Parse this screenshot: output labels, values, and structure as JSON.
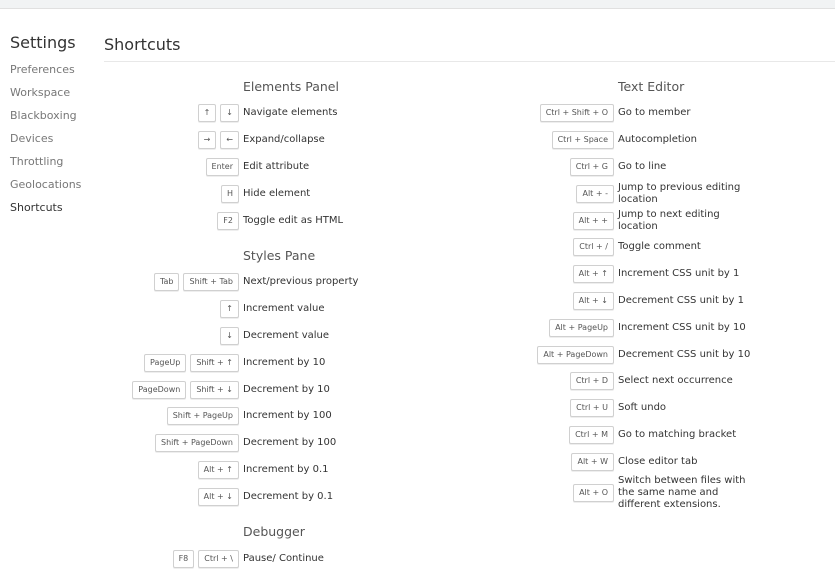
{
  "sidebar": {
    "title": "Settings",
    "items": [
      "Preferences",
      "Workspace",
      "Blackboxing",
      "Devices",
      "Throttling",
      "Geolocations",
      "Shortcuts"
    ]
  },
  "main": {
    "title": "Shortcuts"
  },
  "elements_panel": {
    "title": "Elements Panel",
    "rows": [
      {
        "keys": [
          "↑",
          "↓"
        ],
        "desc": "Navigate elements"
      },
      {
        "keys": [
          "→",
          "←"
        ],
        "desc": "Expand/collapse"
      },
      {
        "keys": [
          "Enter"
        ],
        "desc": "Edit attribute"
      },
      {
        "keys": [
          "H"
        ],
        "desc": "Hide element"
      },
      {
        "keys": [
          "F2"
        ],
        "desc": "Toggle edit as HTML"
      }
    ]
  },
  "styles_pane": {
    "title": "Styles Pane",
    "rows": [
      {
        "keys": [
          "Tab",
          "Shift + Tab"
        ],
        "desc": "Next/previous property"
      },
      {
        "keys": [
          "↑"
        ],
        "desc": "Increment value"
      },
      {
        "keys": [
          "↓"
        ],
        "desc": "Decrement value"
      },
      {
        "keys": [
          "PageUp",
          "Shift + ↑"
        ],
        "desc": "Increment by 10"
      },
      {
        "keys": [
          "PageDown",
          "Shift + ↓"
        ],
        "desc": "Decrement by 10"
      },
      {
        "keys": [
          "Shift + PageUp"
        ],
        "desc": "Increment by 100"
      },
      {
        "keys": [
          "Shift + PageDown"
        ],
        "desc": "Decrement by 100"
      },
      {
        "keys": [
          "Alt + ↑"
        ],
        "desc": "Increment by 0.1"
      },
      {
        "keys": [
          "Alt + ↓"
        ],
        "desc": "Decrement by 0.1"
      }
    ]
  },
  "debugger": {
    "title": "Debugger",
    "rows": [
      {
        "keys": [
          "F8",
          "Ctrl + \\"
        ],
        "desc": "Pause/ Continue"
      }
    ]
  },
  "text_editor": {
    "title": "Text Editor",
    "rows": [
      {
        "keys": [
          "Ctrl + Shift + O"
        ],
        "desc": "Go to member"
      },
      {
        "keys": [
          "Ctrl + Space"
        ],
        "desc": "Autocompletion"
      },
      {
        "keys": [
          "Ctrl + G"
        ],
        "desc": "Go to line"
      },
      {
        "keys": [
          "Alt + -"
        ],
        "desc": "Jump to previous editing location"
      },
      {
        "keys": [
          "Alt + +"
        ],
        "desc": "Jump to next editing location"
      },
      {
        "keys": [
          "Ctrl + /"
        ],
        "desc": "Toggle comment"
      },
      {
        "keys": [
          "Alt + ↑"
        ],
        "desc": "Increment CSS unit by 1"
      },
      {
        "keys": [
          "Alt + ↓"
        ],
        "desc": "Decrement CSS unit by 1"
      },
      {
        "keys": [
          "Alt + PageUp"
        ],
        "desc": "Increment CSS unit by 10"
      },
      {
        "keys": [
          "Alt + PageDown"
        ],
        "desc": "Decrement CSS unit by 10"
      },
      {
        "keys": [
          "Ctrl + D"
        ],
        "desc": "Select next occurrence"
      },
      {
        "keys": [
          "Ctrl + U"
        ],
        "desc": "Soft undo"
      },
      {
        "keys": [
          "Ctrl + M"
        ],
        "desc": "Go to matching bracket"
      },
      {
        "keys": [
          "Alt + W"
        ],
        "desc": "Close editor tab"
      },
      {
        "keys": [
          "Alt + O"
        ],
        "desc": "Switch between files with the same name and different extensions."
      }
    ]
  }
}
